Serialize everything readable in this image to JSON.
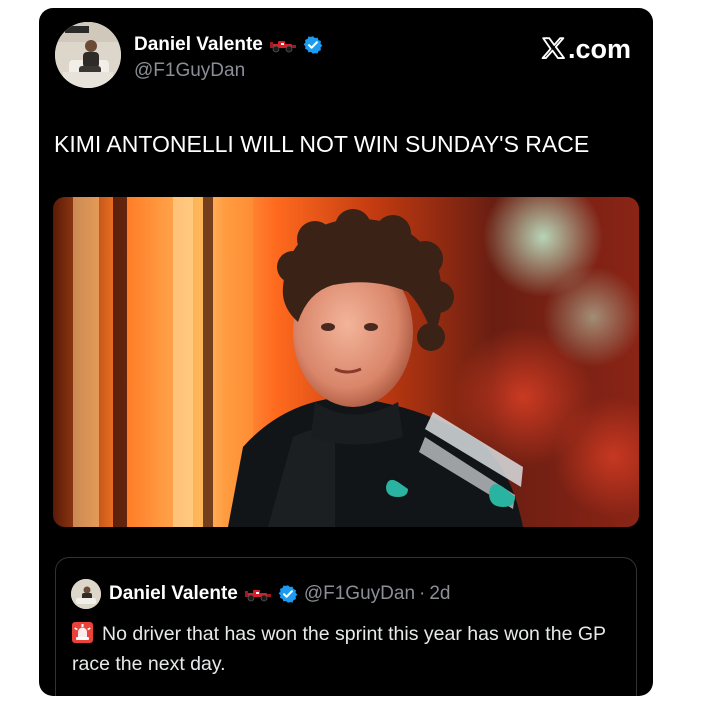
{
  "post": {
    "author": {
      "name": "Daniel Valente",
      "handle": "@F1GuyDan",
      "verified": true,
      "badge_icon": "f1-car-icon",
      "avatar_icon": "profile-photo"
    },
    "site_label": ".com",
    "site_icon": "x-logo-icon",
    "text": "KIMI ANTONELLI WILL NOT WIN SUNDAY'S RACE",
    "photo": {
      "description_icon": "driver-photo",
      "colors": {
        "background_warm": "#ff7a2a",
        "suit": "#111418",
        "teal": "#29b3a0"
      }
    }
  },
  "quoted_post": {
    "author": {
      "name": "Daniel Valente",
      "handle": "@F1GuyDan",
      "verified": true,
      "badge_icon": "f1-car-icon"
    },
    "separator": "·",
    "time": "2d",
    "emoji_icon": "rotating-light-icon",
    "text": "No driver that has won the sprint this year has won the GP race the next day."
  },
  "colors": {
    "card_background": "#000000",
    "page_background": "#ffffff",
    "verified_blue": "#1d9bf0",
    "muted_text": "#8b8f95",
    "border": "#2f3336"
  }
}
